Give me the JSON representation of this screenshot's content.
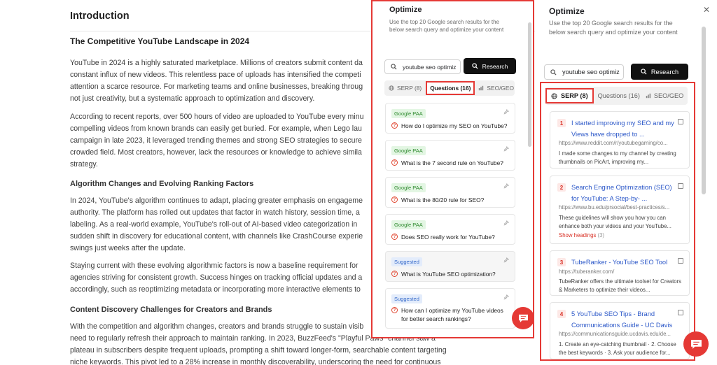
{
  "article": {
    "h1": "Introduction",
    "h2": "The Competitive YouTube Landscape in 2024",
    "p1": [
      "YouTube in 2024 is a highly saturated marketplace. Millions of creators submit content da",
      "constant influx of new videos. This relentless pace of uploads has intensified the competi",
      "attention a scarce resource. For marketing teams and online businesses, breaking throug",
      "not just creativity, but a systematic approach to optimization and discovery."
    ],
    "p2": [
      "According to recent reports, over 500 hours of video are uploaded to YouTube every minu",
      "compelling videos from known brands can easily get buried. For example, when Lego lau",
      "campaign in late 2023, it leveraged trending themes and strong SEO strategies to secure",
      "crowded field. Most creators, however, lack the resources or knowledge to achieve simila",
      "strategy."
    ],
    "h3a": "Algorithm Changes and Evolving Ranking Factors",
    "p3": [
      "In 2024, YouTube's algorithm continues to adapt, placing greater emphasis on engageme",
      "authority. The platform has rolled out updates that factor in watch history, session time, a",
      "labeling. As a real-world example, YouTube's roll-out of AI-based video categorization in",
      "sudden shift in discovery for educational content, with channels like CrashCourse experie",
      "swings just weeks after the update."
    ],
    "p4": [
      "Staying current with these evolving algorithmic factors is now a baseline requirement for",
      "agencies striving for consistent growth. Success hinges on tracking official updates and a",
      "accordingly, such as reoptimizing metadata or incorporating more interactive elements to"
    ],
    "h3b": "Content Discovery Challenges for Creators and Brands",
    "p5": [
      "With the competition and algorithm changes, creators and brands struggle to sustain visib",
      "need to regularly refresh their approach to maintain ranking. In 2023, BuzzFeed's \"Playful Paws\" channel saw a",
      "plateau in subscribers despite frequent uploads, prompting a shift toward longer-form, searchable content targeting",
      "niche keywords. This pivot led to a 28% increase in monthly discoverability, underscoring the need for continuous"
    ]
  },
  "panel1": {
    "title": "Optimize",
    "desc": "Use the top 20 Google search results for the below search query and optimize your content",
    "search_value": "youtube seo optimiz",
    "research_label": "Research",
    "tabs": {
      "serp": "SERP (8)",
      "questions": "Questions (16)",
      "seo": "SEO/GEO"
    },
    "questions": [
      {
        "badge": "Google PAA",
        "text": "How do I optimize my SEO on YouTube?"
      },
      {
        "badge": "Google PAA",
        "text": "What is the 7 second rule on YouTube?"
      },
      {
        "badge": "Google PAA",
        "text": "What is the 80/20 rule for SEO?"
      },
      {
        "badge": "Google PAA",
        "text": "Does SEO really work for YouTube?"
      },
      {
        "badge": "Suggested",
        "text": "What is YouTube SEO optimization?"
      },
      {
        "badge": "Suggested",
        "text": "How can I optimize my YouTube videos for better search rankings?"
      }
    ]
  },
  "panel2": {
    "title": "Optimize",
    "desc": "Use the top 20 Google search results for the below search query and optimize your content",
    "search_value": "youtube seo optimiz",
    "research_label": "Research",
    "tabs": {
      "serp": "SERP (8)",
      "questions": "Questions (16)",
      "seo": "SEO/GEO"
    },
    "results": [
      {
        "num": "1",
        "title": "I started improving my SEO and my Views have dropped to ...",
        "url": "https://www.reddit.com/r/youtubegaming/co...",
        "desc": "I made some changes to my channel by creating thumbnails on PicArt, improving my..."
      },
      {
        "num": "2",
        "title": "Search Engine Optimization (SEO) for YouTube: A Step-by- ...",
        "url": "https://www.bu.edu/prsocial/best-practices/s...",
        "desc": "These guidelines will show you how you can enhance both your videos and your YouTube...",
        "show_headings": "Show headings",
        "headings_count": "(3)"
      },
      {
        "num": "3",
        "title": "TubeRanker - YouTube SEO Tool",
        "url": "https://tuberanker.com/",
        "desc": "TubeRanker offers the ultimate toolset for Creators & Marketers to optimize their videos..."
      },
      {
        "num": "4",
        "title": "5 YouTube SEO Tips - Brand Communications Guide - UC Davis",
        "url": "https://communicationsguide.ucdavis.edu/de...",
        "desc": "1. Create an eye-catching thumbnail · 2. Choose the best keywords · 3. Ask your audience for..."
      }
    ]
  },
  "colors": {
    "accent": "#e53935",
    "link": "#2b57c8",
    "paa_badge": "#2f8a2f",
    "suggested_badge": "#3569c9"
  }
}
